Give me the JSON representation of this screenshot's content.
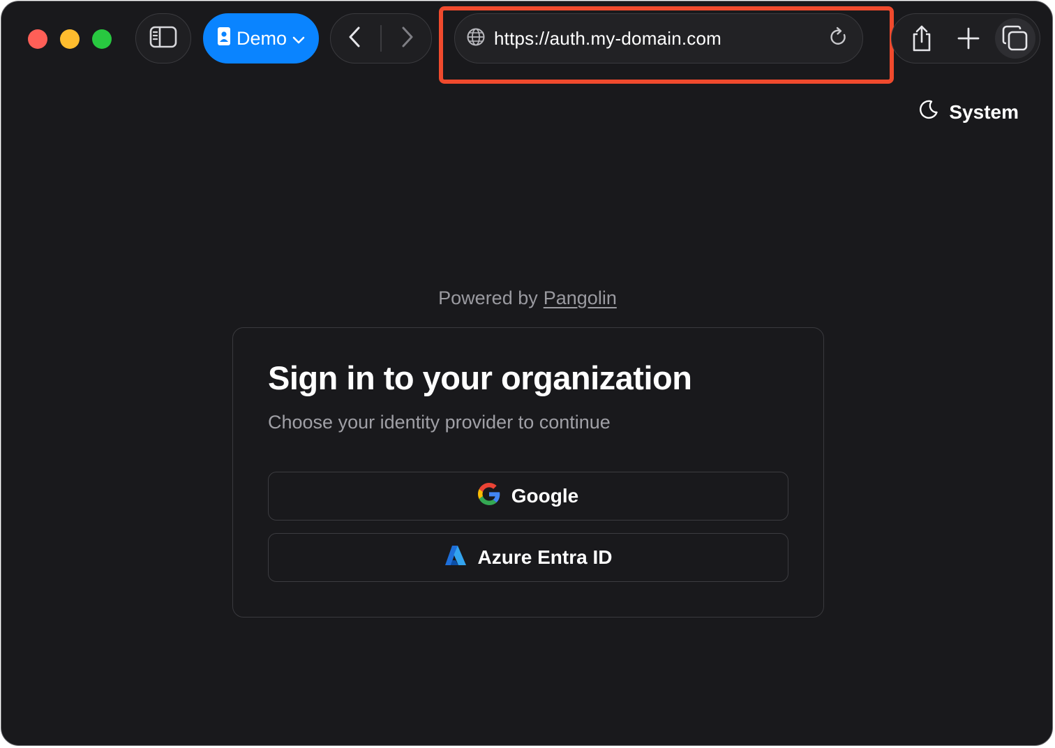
{
  "browser": {
    "profile_label": "Demo",
    "address_url": "https://auth.my-domain.com"
  },
  "theme": {
    "label": "System"
  },
  "page": {
    "powered_prefix": "Powered by",
    "powered_link": "Pangolin",
    "title": "Sign in to your organization",
    "subtitle": "Choose your identity provider to continue",
    "providers": [
      {
        "label": "Google",
        "icon": "google-logo-icon"
      },
      {
        "label": "Azure Entra ID",
        "icon": "azure-logo-icon"
      }
    ]
  },
  "colors": {
    "background": "#19191c",
    "accent": "#0a84ff",
    "highlight": "#f04a2d",
    "muted_text": "#9a9aa0"
  }
}
